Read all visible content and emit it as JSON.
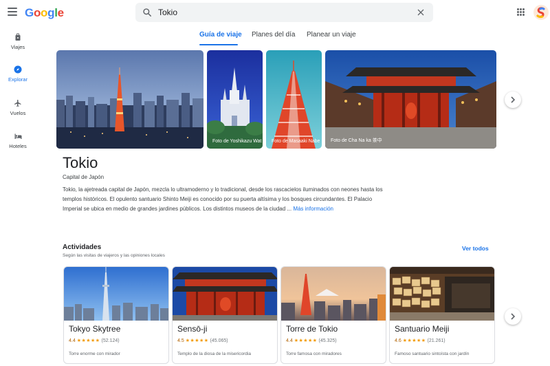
{
  "header": {
    "logo_text": "Google",
    "search_value": "Tokio",
    "icons": [
      "menu-icon",
      "search-icon",
      "clear-icon",
      "apps-icon",
      "avatar"
    ]
  },
  "sidebar": {
    "items": [
      {
        "label": "Viajes",
        "icon": "suitcase-icon",
        "active": false
      },
      {
        "label": "Explorar",
        "icon": "compass-icon",
        "active": true
      },
      {
        "label": "Vuelos",
        "icon": "plane-icon",
        "active": false
      },
      {
        "label": "Hoteles",
        "icon": "bed-icon",
        "active": false
      }
    ]
  },
  "tabs": [
    {
      "label": "Guía de viaje",
      "active": true
    },
    {
      "label": "Planes del día",
      "active": false
    },
    {
      "label": "Planear un viaje",
      "active": false
    }
  ],
  "gallery": {
    "credits": [
      "Foto de Yoshikazu Wat",
      "Foto de Masaaki Nabe",
      "Foto de Cha Na ka 茶中"
    ]
  },
  "place": {
    "title": "Tokio",
    "subtitle": "Capital de Japón",
    "description": "Tokio, la ajetreada capital de Japón, mezcla lo ultramoderno y lo tradicional, desde los rascacielos iluminados con neones hasta los templos históricos. El opulento santuario Shinto Meiji es conocido por su puerta altísima y los bosques circundantes. El Palacio Imperial se ubica en medio de grandes jardines públicos. Los distintos museos de la ciudad ...",
    "more_label": "Más información"
  },
  "activities": {
    "title": "Actividades",
    "subtitle": "Según las visitas de viajeros y las opiniones locales",
    "see_all_label": "Ver todos",
    "items": [
      {
        "name": "Tokyo Skytree",
        "rating": "4.4",
        "stars": "★★★★★",
        "reviews": "(52.124)",
        "description": "Torre enorme con mirador"
      },
      {
        "name": "Sensō-ji",
        "rating": "4.5",
        "stars": "★★★★★",
        "reviews": "(45.065)",
        "description": "Templo de la diosa de la misericordia"
      },
      {
        "name": "Torre de Tokio",
        "rating": "4.4",
        "stars": "★★★★★",
        "reviews": "(45.325)",
        "description": "Torre famosa con miradores"
      },
      {
        "name": "Santuario Meiji",
        "rating": "4.6",
        "stars": "★★★★★",
        "reviews": "(21.261)",
        "description": "Famoso santuario sintoísta con jardín"
      }
    ]
  },
  "colors": {
    "accent": "#1a73e8",
    "rating": "#b06000",
    "stars": "#f29900"
  }
}
